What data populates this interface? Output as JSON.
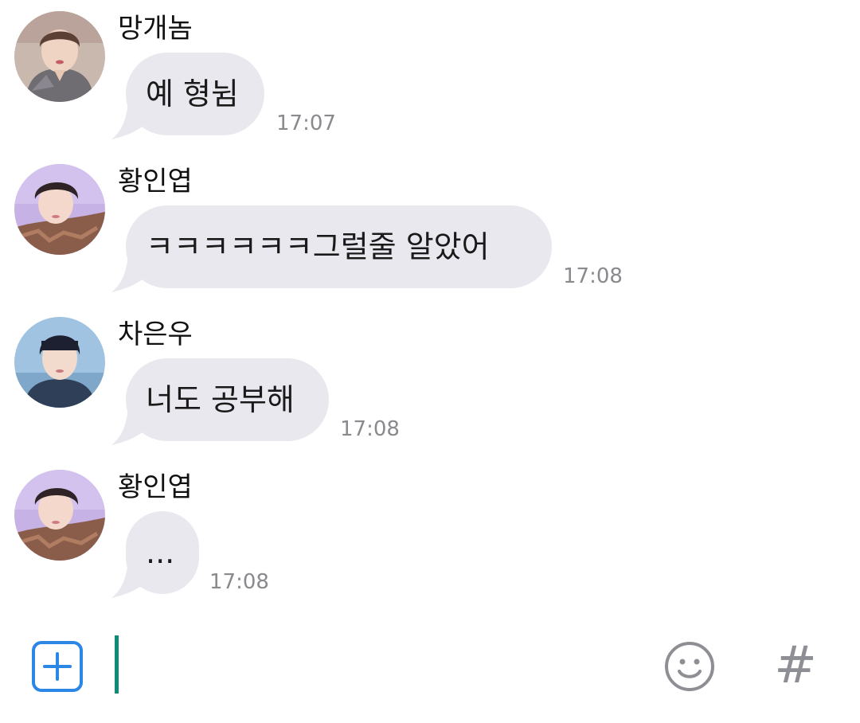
{
  "messages": [
    {
      "sender": "망개놈",
      "text": "예 형뉨",
      "time": "17:07",
      "avatar": "avatar-jimin"
    },
    {
      "sender": "황인엽",
      "text": "ㅋㅋㅋㅋㅋㅋ그럴줄 알았어",
      "time": "17:08",
      "avatar": "avatar-inyeop"
    },
    {
      "sender": "차은우",
      "text": "너도 공부해",
      "time": "17:08",
      "avatar": "avatar-eunwoo"
    },
    {
      "sender": "황인엽",
      "text": "...",
      "time": "17:08",
      "avatar": "avatar-inyeop"
    }
  ],
  "input_bar": {
    "value": "",
    "plus_icon": "plus-square-icon",
    "emoji_icon": "smiley-icon",
    "hash_label": "#"
  },
  "colors": {
    "bubble": "#e9e8ee",
    "accent_blue": "#2b86e6",
    "cursor_green": "#0f8a76",
    "timestamp": "#8a8a8e",
    "icon_gray": "#8e8f94"
  }
}
